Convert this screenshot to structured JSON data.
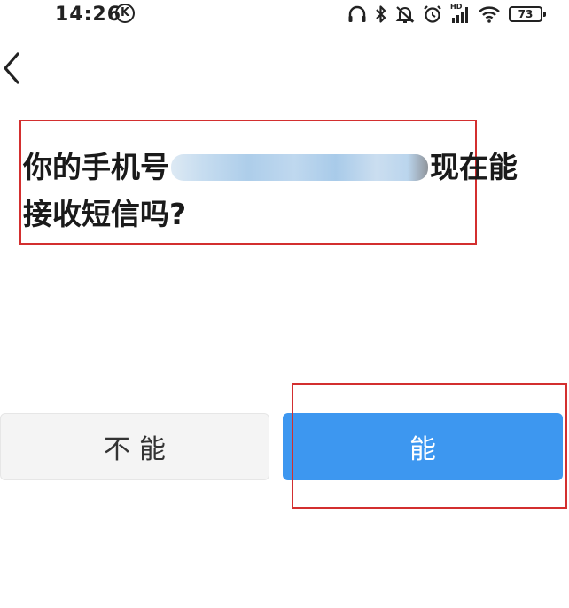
{
  "status_bar": {
    "time": "14:26",
    "k_badge": "K",
    "network_badge": "HD",
    "battery_level": "73",
    "icons": [
      "headphones-icon",
      "bluetooth-icon",
      "mute-icon",
      "alarm-icon",
      "signal-icon",
      "wifi-icon",
      "battery-icon"
    ]
  },
  "navigation": {
    "back_icon": "chevron-left-icon"
  },
  "question": {
    "prefix": "你的手机号",
    "suffix": "现在能接收短信吗?"
  },
  "buttons": {
    "no_label": "不能",
    "yes_label": "能"
  },
  "colors": {
    "primary": "#3d97f0",
    "secondary_bg": "#f4f4f4",
    "highlight_border": "#d32f2f"
  }
}
